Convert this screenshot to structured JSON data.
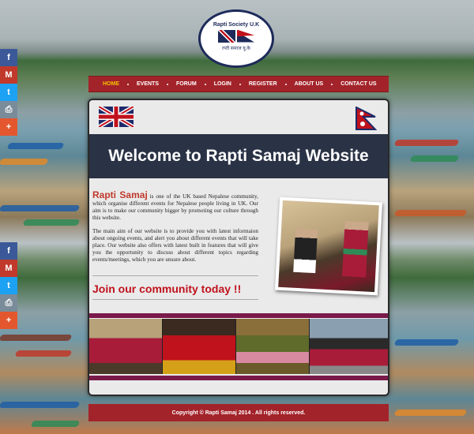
{
  "logo": {
    "top_text": "Rapti Society U.K",
    "bottom_text": "रप्ती समाज यु.के"
  },
  "nav": {
    "items": [
      {
        "label": "HOME",
        "active": true
      },
      {
        "label": "EVENTS",
        "active": false
      },
      {
        "label": "FORUM",
        "active": false
      },
      {
        "label": "LOGIN",
        "active": false
      },
      {
        "label": "REGISTER",
        "active": false
      },
      {
        "label": "ABOUT US",
        "active": false
      },
      {
        "label": "CONTACT US",
        "active": false
      }
    ]
  },
  "share": {
    "icons": [
      "facebook-icon",
      "gmail-icon",
      "twitter-icon",
      "print-icon",
      "more-icon"
    ],
    "glyphs": [
      "f",
      "M",
      "t",
      "⎙",
      "+"
    ],
    "colors": [
      "#3b5998",
      "#c0392b",
      "#1da1f2",
      "#7a8b99",
      "#e4572e"
    ]
  },
  "main": {
    "banner_title": "Welcome to Rapti Samaj Website",
    "brand": "Rapti Samaj",
    "intro": " is one of the UK based Nepalese community, which organise different events for Nepalese people living in UK. Our aim is to make our community bigger by promoting our culture through this website.",
    "para2": "The main aim of our website is to provide you with latest informaion about ongoing events, and alert you about different events that will take place. Our website also offers with latest built in features that will give you the opportunity to discuss about different topics regarding events/meetings, which you are unsure about.",
    "join_text": "Join our community today !!"
  },
  "footer": {
    "text": "Copyright © Rapti Samaj 2014 . All rights reserved."
  },
  "colors": {
    "nav_bg": "#a3232a",
    "active_nav": "#f5c400",
    "banner_bg": "#2a3245",
    "accent_red": "#c0121c"
  }
}
